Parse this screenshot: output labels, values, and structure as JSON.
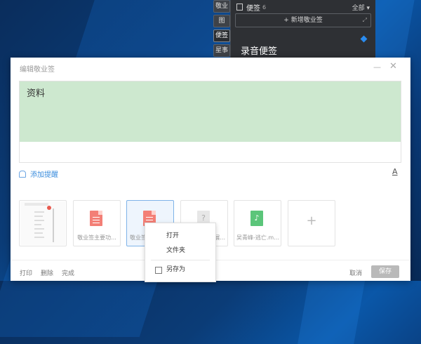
{
  "background_windows": {
    "side_tabs": [
      "敬业",
      "图",
      "便签",
      "星事"
    ],
    "notes_panel": {
      "title": "便签",
      "count": "6",
      "filter": "全部 ▾",
      "new_button": "+ 新增敬业签",
      "note_title": "录音便签"
    }
  },
  "dialog": {
    "title": "编辑敬业签",
    "minimize_glyph": "—",
    "close_glyph": "✕",
    "editor_text": "资料",
    "add_reminder": "添加提醒",
    "font_format": "A",
    "attachments": [
      {
        "name": ""
      },
      {
        "name": "敬业签主要功..."
      },
      {
        "name": "敬业签"
      },
      {
        "name": "展..."
      },
      {
        "name": "吴青峰-逃亡.m..."
      }
    ],
    "add_attachment": "+",
    "footer": {
      "print": "打印",
      "delete": "删除",
      "complete": "完成",
      "cancel": "取消",
      "save": "保存"
    }
  },
  "context_menu": {
    "items": [
      "打开",
      "文件夹",
      "另存为"
    ]
  },
  "colors": {
    "editor_background": "#cde8cf",
    "accent_link": "#3b8ddd",
    "save_button": "#b9b9b9",
    "notes_panel_bg": "#2e3034"
  }
}
